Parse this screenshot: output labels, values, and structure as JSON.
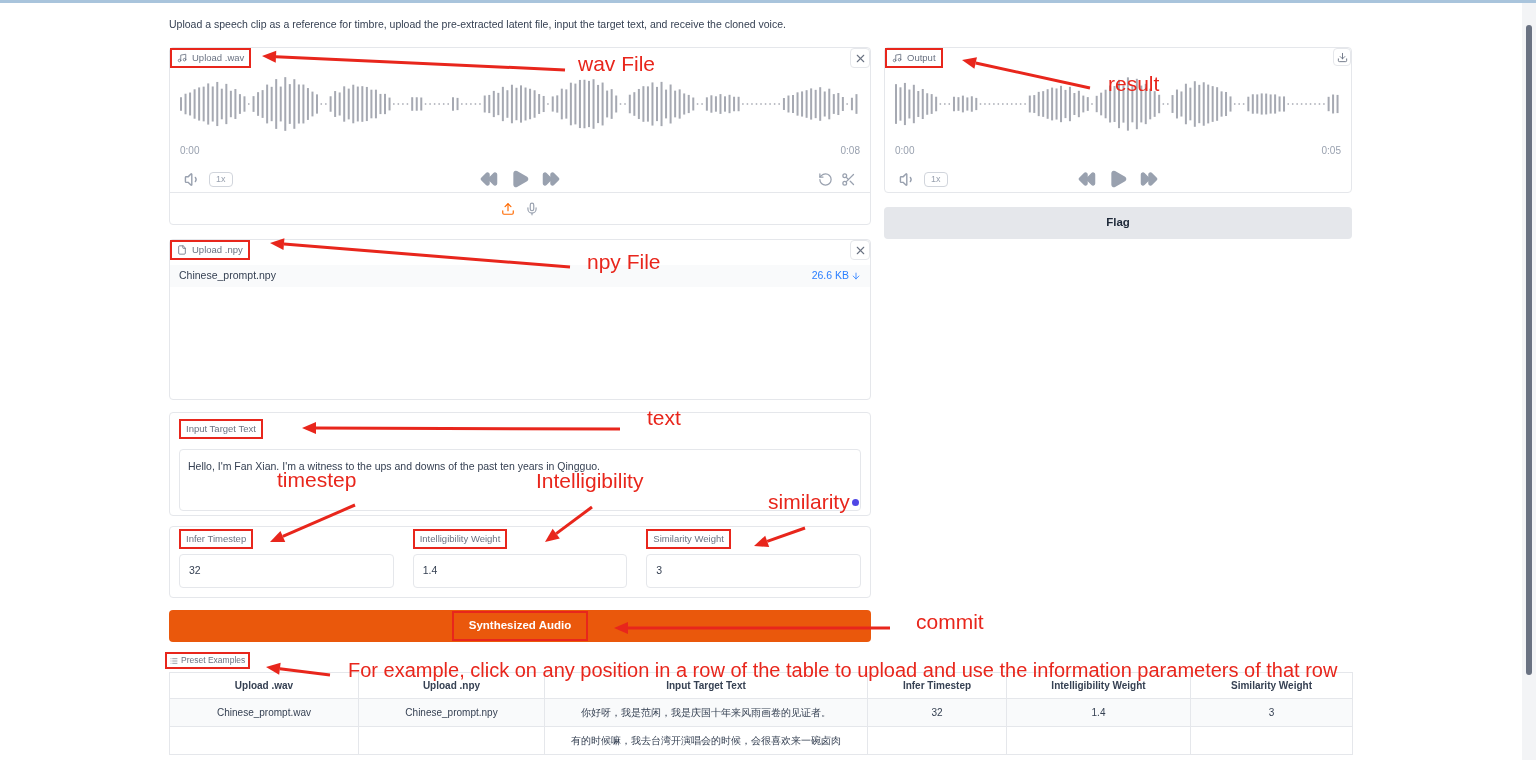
{
  "description": "Upload a speech clip as a reference for timbre, upload the pre-extracted latent file, input the target text, and receive the cloned voice.",
  "audio_input": {
    "label": "Upload .wav",
    "time_start": "0:00",
    "time_end": "0:08",
    "speed": "1x"
  },
  "file_input": {
    "label": "Upload .npy",
    "file_name": "Chinese_prompt.npy",
    "file_size": "26.6 KB"
  },
  "text_input": {
    "label": "Input Target Text",
    "value": "Hello, I'm Fan Xian. I'm a witness to the ups and downs of the past ten years in Qingguo."
  },
  "number_inputs": [
    {
      "label": "Infer Timestep",
      "value": "32"
    },
    {
      "label": "Intelligibility Weight",
      "value": "1.4"
    },
    {
      "label": "Similarity Weight",
      "value": "3"
    }
  ],
  "submit_button": "Synthesized Audio",
  "output_audio": {
    "label": "Output",
    "time_start": "0:00",
    "time_end": "0:05",
    "speed": "1x"
  },
  "flag_button": "Flag",
  "examples": {
    "label": "Preset Examples",
    "columns": [
      "Upload .wav",
      "Upload .npy",
      "Input Target Text",
      "Infer Timestep",
      "Intelligibility Weight",
      "Similarity Weight"
    ],
    "rows": [
      {
        "cells": [
          "Chinese_prompt.wav",
          "Chinese_prompt.npy",
          "你好呀，我是范闲，我是庆国十年来风雨画卷的见证者。",
          "32",
          "1.4",
          "3"
        ]
      },
      {
        "cells": [
          null,
          null,
          "有的时候嘛，我去台湾开演唱会的时候，会很喜欢来一碗卤肉",
          null,
          null,
          null
        ]
      }
    ]
  },
  "annotations": [
    {
      "text": "wav File"
    },
    {
      "text": "result"
    },
    {
      "text": "npy File"
    },
    {
      "text": "text"
    },
    {
      "text": "timestep"
    },
    {
      "text": "Intelligibility"
    },
    {
      "text": "similarity"
    },
    {
      "text": "commit"
    },
    {
      "text": "For example, click on any position in a row of the table to upload and use the information parameters of that row"
    }
  ]
}
